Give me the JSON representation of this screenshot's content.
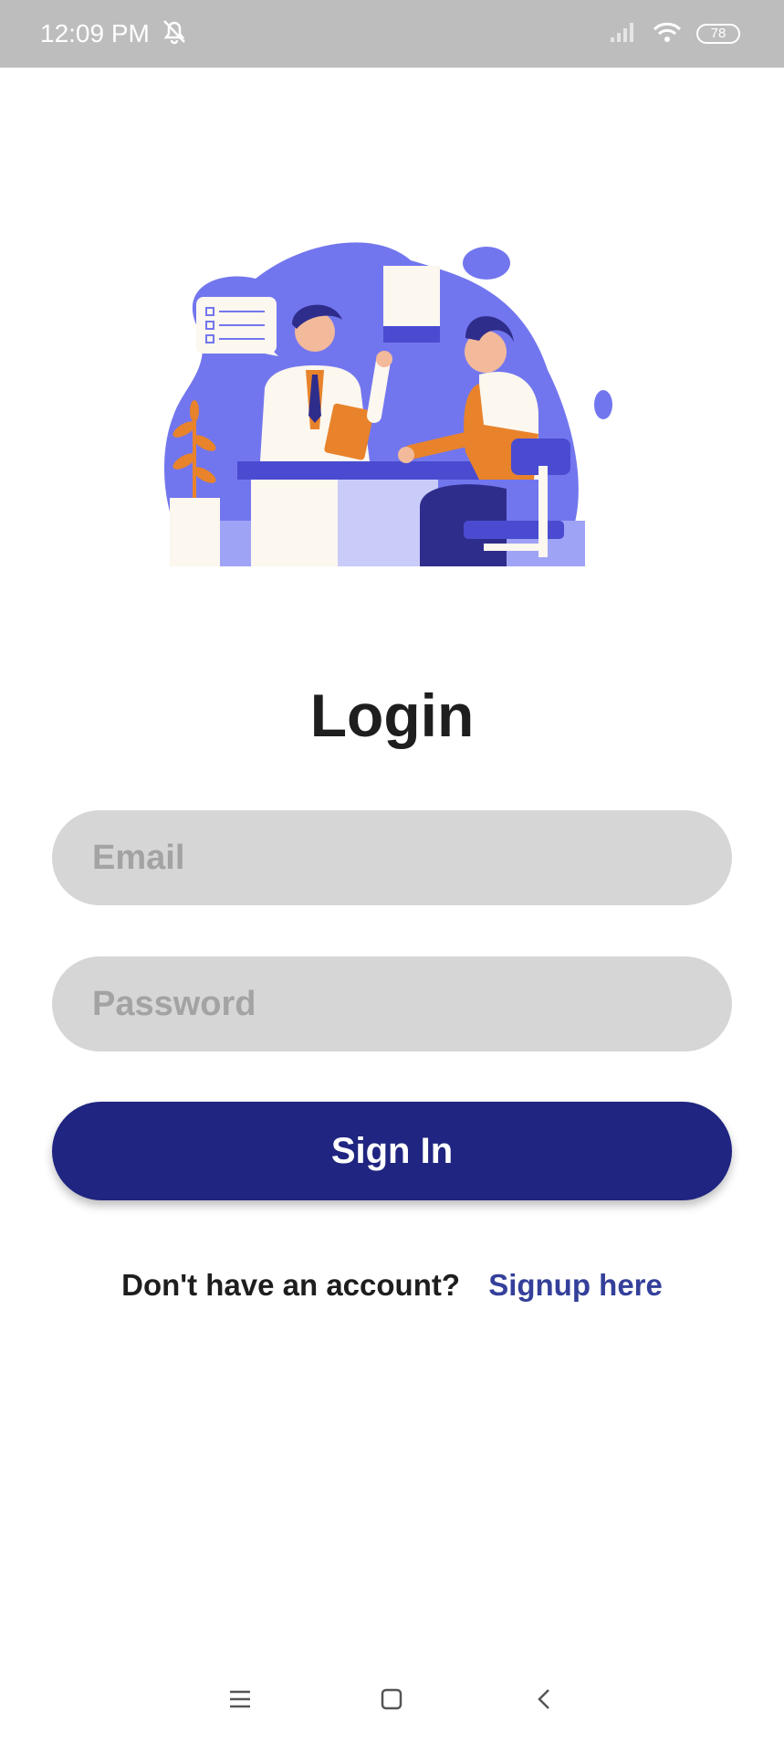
{
  "status_bar": {
    "time": "12:09 PM",
    "battery": "78",
    "icons": [
      "alarm-off-icon",
      "signal-icon",
      "wifi-icon",
      "battery-icon"
    ]
  },
  "illustration": {
    "name": "doctor-patient-consultation-illustration"
  },
  "login": {
    "title": "Login",
    "email_placeholder": "Email",
    "password_placeholder": "Password",
    "signin_label": "Sign In",
    "signup_prompt": "Don't have an account?",
    "signup_link": "Signup here"
  },
  "nav_bar": {
    "icons": [
      "menu-icon",
      "home-icon",
      "back-icon"
    ]
  },
  "colors": {
    "status_bar": "#bdbdbd",
    "primary_button": "#1f2580",
    "input_bg": "#d6d6d6",
    "link": "#34409a",
    "illustration_blob": "#7276ee"
  }
}
